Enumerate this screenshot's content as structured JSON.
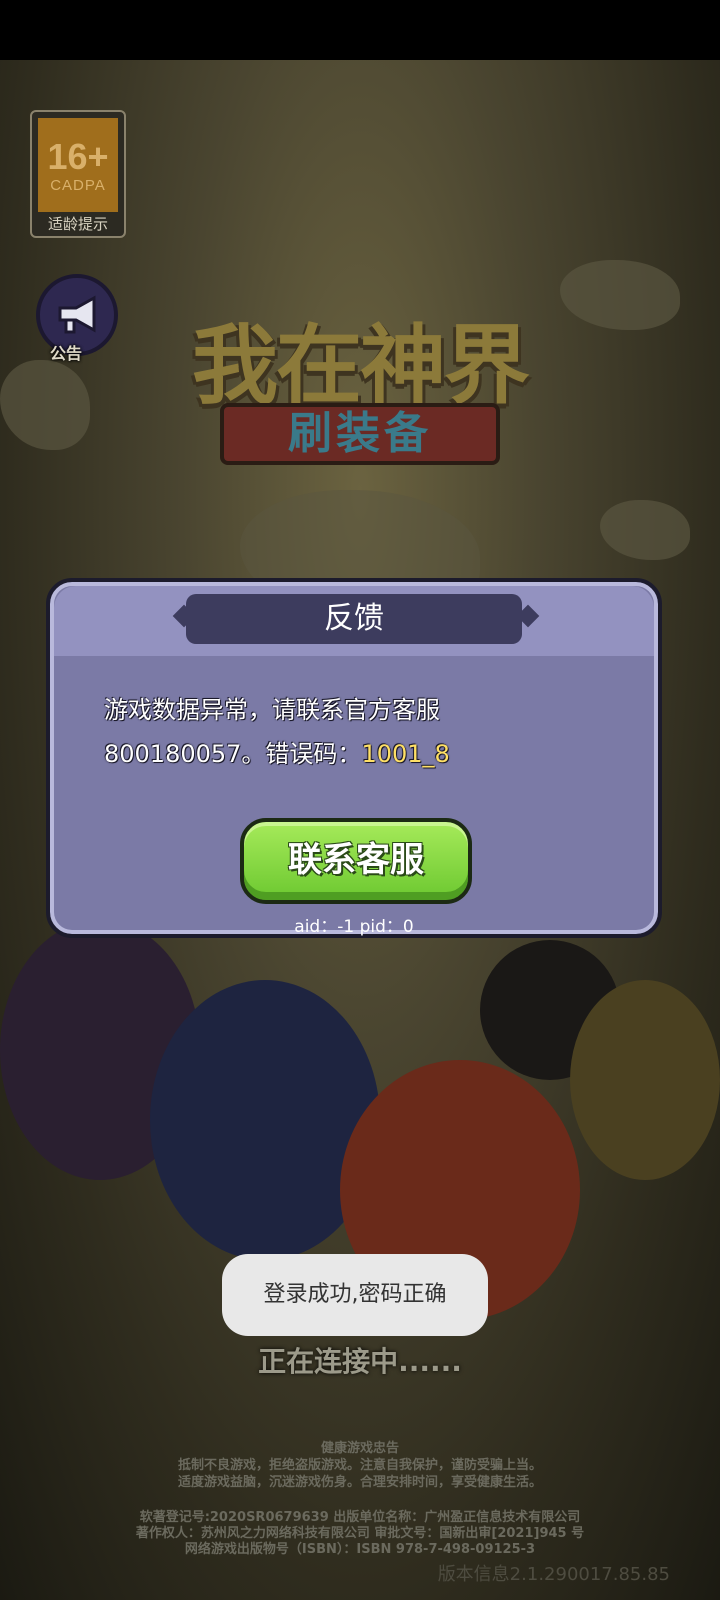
{
  "age_rating": {
    "number": "16+",
    "org": "CADPA",
    "label": "适龄提示"
  },
  "notice": {
    "icon": "megaphone-icon",
    "label": "公告"
  },
  "logo": {
    "title": "我在神界",
    "subtitle": "刷装备"
  },
  "dialog": {
    "title": "反馈",
    "message_line1": "游戏数据异常，请联系官方客服",
    "message_line2": "800180057。错误码：",
    "error_code": "1001_8",
    "button_label": "联系客服",
    "aid_line": "aid：-1 pid：0"
  },
  "toast": "登录成功,密码正确",
  "status_text": "正在连接中......",
  "health_notice": {
    "title": "健康游戏忠告",
    "line1": "抵制不良游戏，拒绝盗版游戏。注意自我保护，谨防受骗上当。",
    "line2": "适度游戏益脑，沉迷游戏伤身。合理安排时间，享受健康生活。"
  },
  "legal": {
    "line1": "软著登记号:2020SR0679639 出版单位名称：广州盈正信息技术有限公司",
    "line2": "著作权人：苏州风之力网络科技有限公司 审批文号：国新出审[2021]945 号",
    "line3": "网络游戏出版物号（ISBN）：ISBN 978-7-498-09125-3"
  },
  "version": "版本信息2.1.290017.85.85",
  "colors": {
    "dialog_bg": "#7b7aa6",
    "button_green": "#7cd33a",
    "error_code": "#ffe066"
  }
}
